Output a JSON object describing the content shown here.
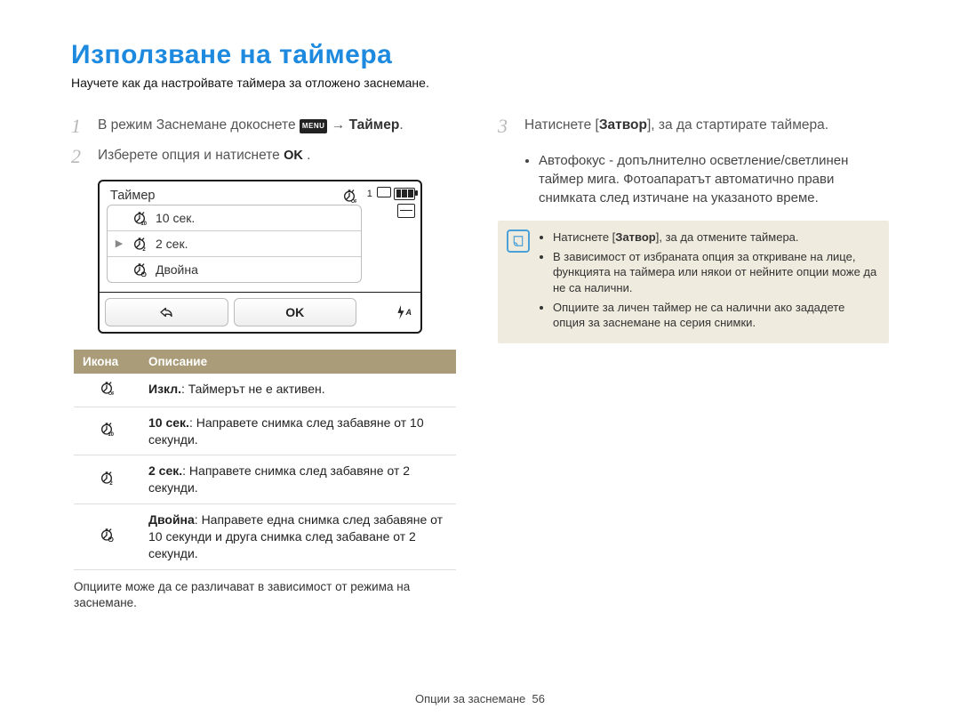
{
  "title": "Използване на таймера",
  "subtitle": "Научете как да настройвате таймера за отложено заснемане.",
  "steps": {
    "s1_pre": "В режим Заснемане докоснете ",
    "s1_post": " → ",
    "s1_bold": "Таймер",
    "s1_end": ".",
    "s2_pre": "Изберете опция и натиснете ",
    "s2_end": ".",
    "s3": "Натиснете [",
    "s3_bold": "Затвор",
    "s3_post": "], за да стартирате таймера."
  },
  "sub_bullet": "Автофокус - допълнително осветление/светлинен таймер мига. Фотоапаратът автоматично прави снимката след изтичане на указаното време.",
  "cam": {
    "title": "Таймер",
    "rows": [
      "10 сек.",
      "2 сек.",
      "Двойна"
    ],
    "ok": "OK",
    "count": "1",
    "flash_label": "A"
  },
  "table": {
    "h1": "Икона",
    "h2": "Описание",
    "rows": [
      {
        "b": "Изкл.",
        "t": ": Таймерът не е активен."
      },
      {
        "b": "10 сек.",
        "t": ": Направете снимка след забавяне от 10 секунди."
      },
      {
        "b": "2 сек.",
        "t": ": Направете снимка след забавяне от 2 секунди."
      },
      {
        "b": "Двойна",
        "t": ": Направете една снимка след забавяне от 10 секунди и друга снимка след забаване от 2 секунди."
      }
    ]
  },
  "note": "Опциите може да се различават в зависимост от режима на заснемане.",
  "info": [
    "Натиснете [Затвор], за да отмените таймера.",
    "В зависимост от избраната опция за откриване на лице, функцията на таймера или някои от нейните опции може да не са налични.",
    "Опциите за личен таймер не са налични ако зададете опция за заснемане на серия снимки."
  ],
  "footer_label": "Опции за заснемане",
  "footer_page": "56"
}
